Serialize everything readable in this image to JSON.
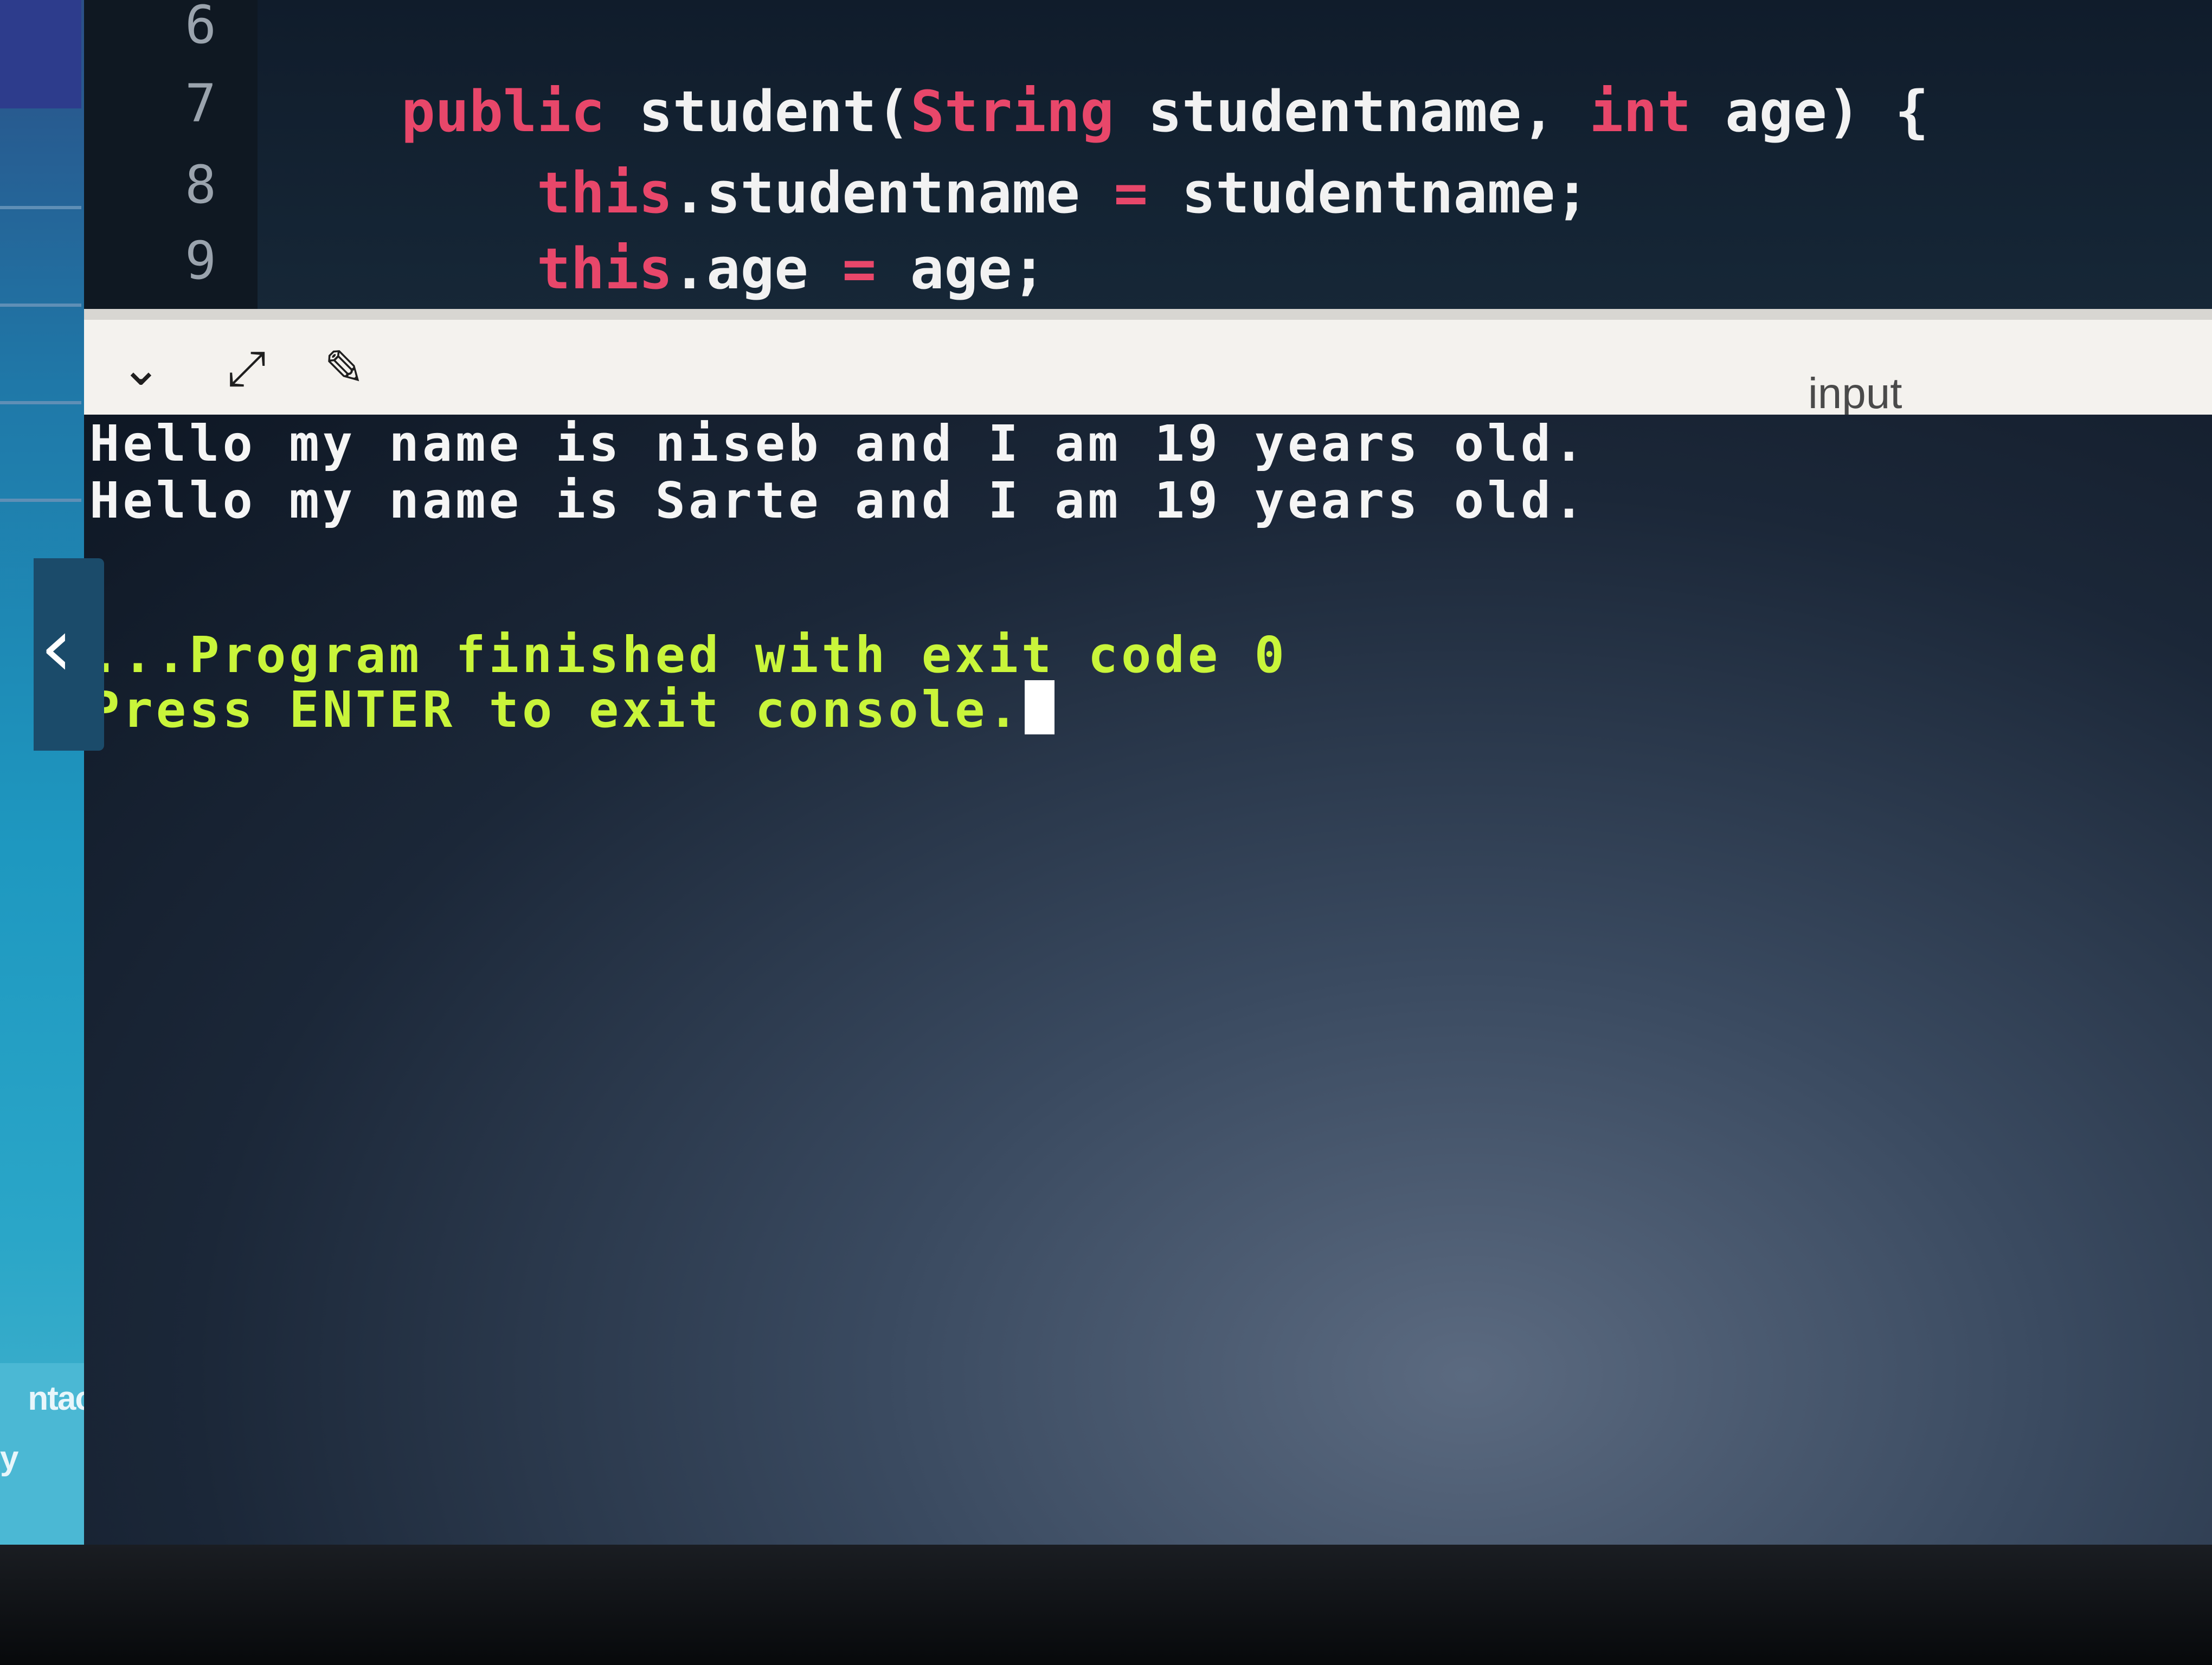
{
  "editor": {
    "lines": [
      {
        "number": "6",
        "tokens": []
      },
      {
        "number": "7",
        "tokens": [
          {
            "text": "public",
            "kind": "kw"
          },
          {
            "text": " student(",
            "kind": "plain"
          },
          {
            "text": "String",
            "kind": "ty"
          },
          {
            "text": " studentname, ",
            "kind": "plain"
          },
          {
            "text": "int",
            "kind": "ty"
          },
          {
            "text": " age) {",
            "kind": "plain"
          }
        ]
      },
      {
        "number": "8",
        "tokens": [
          {
            "text": "this",
            "kind": "kw"
          },
          {
            "text": ".studentname ",
            "kind": "plain"
          },
          {
            "text": "=",
            "kind": "op"
          },
          {
            "text": " studentname;",
            "kind": "plain"
          }
        ]
      },
      {
        "number": "9",
        "tokens": [
          {
            "text": "this",
            "kind": "kw"
          },
          {
            "text": ".age ",
            "kind": "plain"
          },
          {
            "text": "=",
            "kind": "op"
          },
          {
            "text": " age;",
            "kind": "plain"
          }
        ]
      }
    ]
  },
  "console_toolbar": {
    "icons": [
      "chevron-down-icon",
      "expand-icon",
      "clear-icon"
    ],
    "input_label": "input"
  },
  "console": {
    "output_lines": [
      "Hello my name is niseb and I am 19 years old.",
      "Hello my name is Sarte and I am 19 years old."
    ],
    "status_lines": [
      "...Program finished with exit code 0",
      "Press ENTER to exit console."
    ]
  },
  "sidebar": {
    "footer_link": "ntact Us",
    "footer_sub": "y",
    "collapse_glyph": "‹"
  },
  "colors": {
    "keyword": "#e8476a",
    "console_status": "#c9f53a",
    "console_text": "#f5f5f5"
  }
}
